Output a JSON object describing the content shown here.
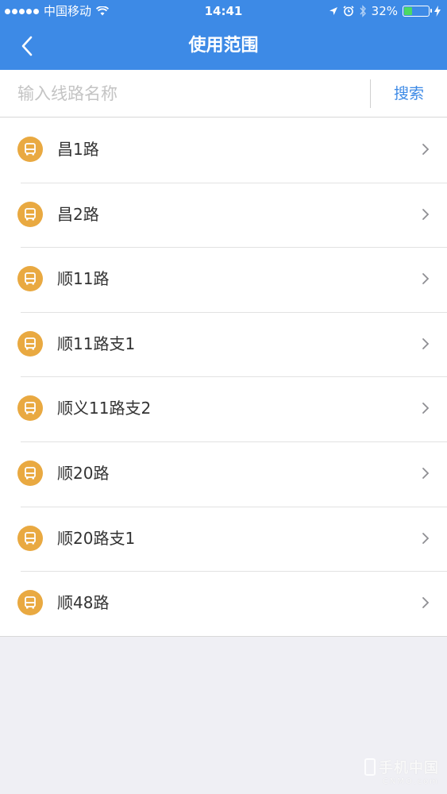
{
  "status_bar": {
    "carrier": "中国移动",
    "time": "14:41",
    "battery": "32%",
    "battery_level": 0.32,
    "icons": [
      "signal-dots",
      "wifi-icon",
      "location-arrow-icon",
      "alarm-icon",
      "bluetooth-icon",
      "battery-icon",
      "charging-bolt-icon"
    ]
  },
  "nav": {
    "title": "使用范围",
    "back_icon": "chevron-left-icon"
  },
  "search": {
    "placeholder": "输入线路名称",
    "value": "",
    "button_label": "搜索"
  },
  "routes": [
    {
      "name": "昌1路"
    },
    {
      "name": "昌2路"
    },
    {
      "name": "顺11路"
    },
    {
      "name": "顺11路支1"
    },
    {
      "name": "顺义11路支2"
    },
    {
      "name": "顺20路"
    },
    {
      "name": "顺20路支1"
    },
    {
      "name": "顺48路"
    }
  ],
  "colors": {
    "header": "#3d8ae6",
    "bus_badge": "#e9a941",
    "accent_text": "#3d8ae6",
    "background": "#efeff4"
  },
  "watermark": {
    "main": "手机中国",
    "sub": "CNMO.com"
  }
}
